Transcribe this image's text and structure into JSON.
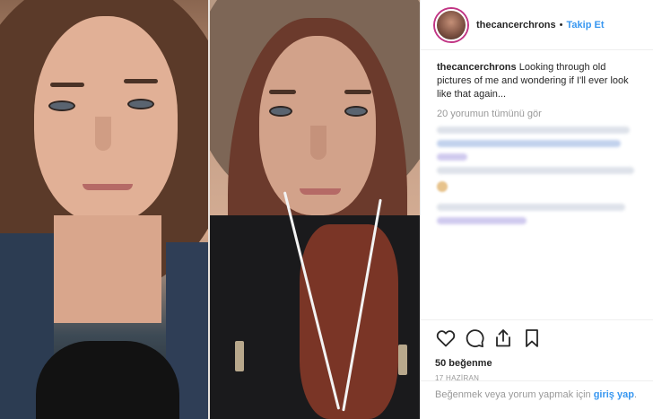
{
  "header": {
    "username": "thecancerchrons",
    "separator": "•",
    "follow_label": "Takip Et"
  },
  "caption": {
    "username": "thecancerchrons",
    "text": "Looking through old pictures of me and wondering if I'll ever look like that again..."
  },
  "comments": {
    "view_all": "20 yorumun tümünü gör"
  },
  "actions": {
    "icons": [
      "heart-icon",
      "comment-icon",
      "share-icon",
      "bookmark-icon"
    ],
    "likes": "50 beğenme",
    "date": "17 HAZİRAN"
  },
  "login": {
    "prefix": "Beğenmek veya yorum yapmak için ",
    "link": "giriş yap",
    "suffix": "."
  },
  "colors": {
    "link_blue": "#3897f0",
    "muted_gray": "#999999",
    "text": "#262626"
  }
}
